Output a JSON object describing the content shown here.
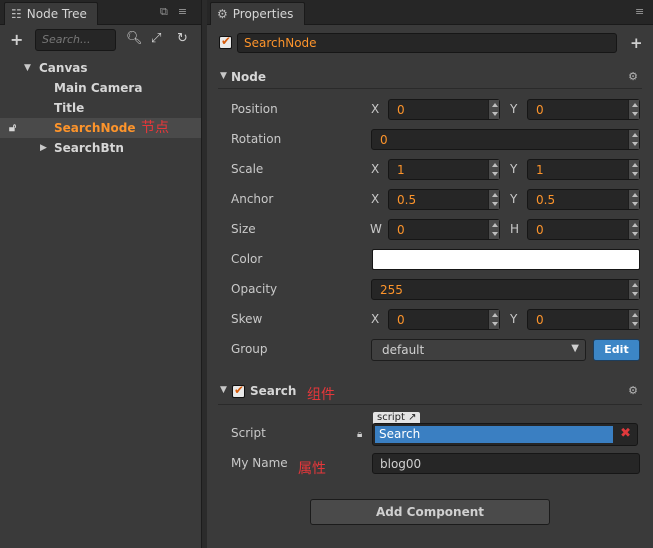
{
  "node_tree": {
    "tab_title": "Node Tree",
    "search_placeholder": "Search...",
    "nodes": [
      {
        "label": "Canvas",
        "expanded": true
      },
      {
        "label": "Main Camera"
      },
      {
        "label": "Title"
      },
      {
        "label": "SearchNode",
        "selected": true,
        "annotation": "节点"
      },
      {
        "label": "SearchBtn",
        "expanded": false
      }
    ]
  },
  "properties": {
    "tab_title": "Properties",
    "node_name": "SearchNode",
    "node_section": {
      "title": "Node",
      "position": {
        "label": "Position",
        "x_label": "X",
        "x": "0",
        "y_label": "Y",
        "y": "0"
      },
      "rotation": {
        "label": "Rotation",
        "value": "0"
      },
      "scale": {
        "label": "Scale",
        "x_label": "X",
        "x": "1",
        "y_label": "Y",
        "y": "1"
      },
      "anchor": {
        "label": "Anchor",
        "x_label": "X",
        "x": "0.5",
        "y_label": "Y",
        "y": "0.5"
      },
      "size": {
        "label": "Size",
        "w_label": "W",
        "w": "0",
        "h_label": "H",
        "h": "0"
      },
      "color": {
        "label": "Color",
        "value": "#ffffff"
      },
      "opacity": {
        "label": "Opacity",
        "value": "255"
      },
      "skew": {
        "label": "Skew",
        "x_label": "X",
        "x": "0",
        "y_label": "Y",
        "y": "0"
      },
      "group": {
        "label": "Group",
        "value": "default",
        "edit_label": "Edit"
      }
    },
    "search_section": {
      "title": "Search",
      "annotation": "组件",
      "script": {
        "label": "Script",
        "tag": "script",
        "value": "Search"
      },
      "my_name": {
        "label": "My Name",
        "annotation": "属性",
        "value": "blog00"
      }
    },
    "add_component_label": "Add Component"
  },
  "colors": {
    "accent_orange": "#fd942b",
    "selection_blue": "#3a7fc2",
    "annotation_red": "#e5373a"
  }
}
